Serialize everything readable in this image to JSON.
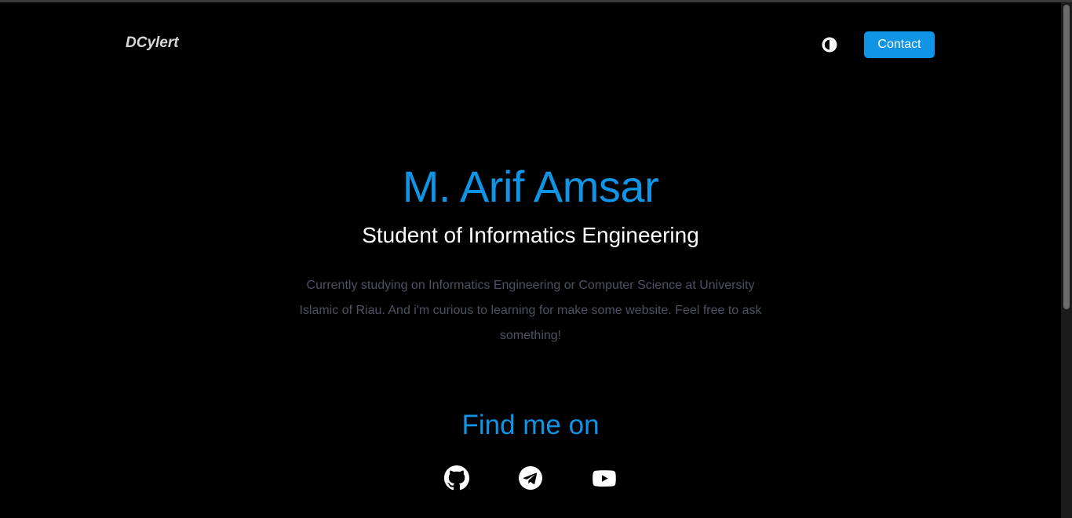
{
  "nav": {
    "brand": "DCylert",
    "theme_toggle_icon": "contrast-icon",
    "contact_label": "Contact"
  },
  "hero": {
    "name": "M. Arif Amsar",
    "role": "Student of Informatics Engineering",
    "description": "Currently studying on Informatics Engineering or Computer Science at University Islamic of Riau. And i'm curious to learning for make some website. Feel free to ask something!"
  },
  "social": {
    "title": "Find me on",
    "links": [
      {
        "icon": "github-icon"
      },
      {
        "icon": "telegram-icon"
      },
      {
        "icon": "youtube-icon"
      }
    ]
  },
  "colors": {
    "accent": "#0f94e6",
    "background": "#000000",
    "muted_text": "#4b5263"
  }
}
